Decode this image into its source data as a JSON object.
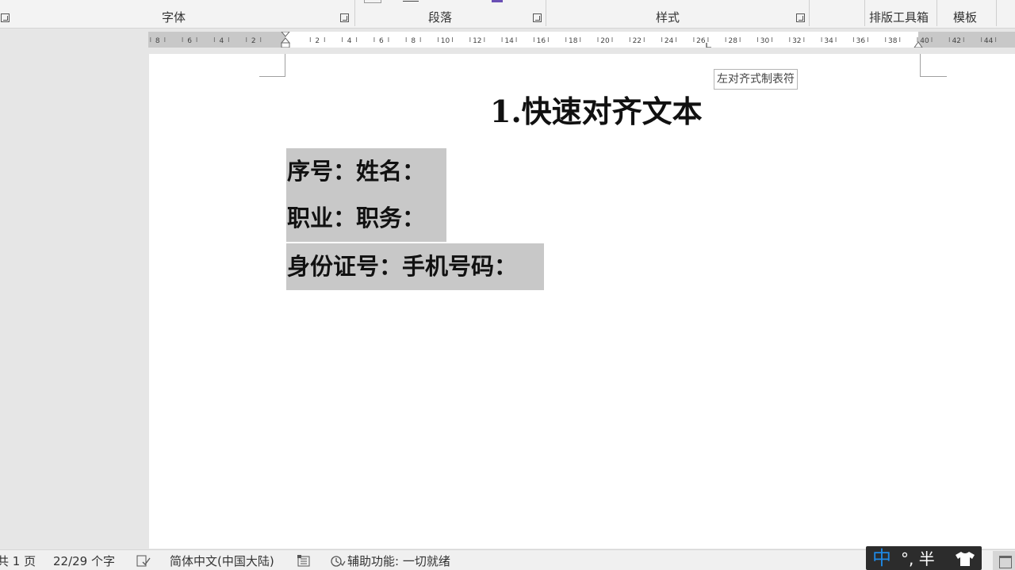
{
  "ribbon": {
    "groups": [
      {
        "label": "字体"
      },
      {
        "label": "段落"
      },
      {
        "label": "样式"
      },
      {
        "label": "排版工具箱"
      },
      {
        "label": "模板"
      }
    ]
  },
  "ruler": {
    "left_labels": [
      "8",
      "6",
      "4",
      "2"
    ],
    "right_labels": [
      "2",
      "4",
      "6",
      "8",
      "10",
      "12",
      "14",
      "16",
      "18",
      "20",
      "22",
      "24",
      "26",
      "28",
      "30",
      "32",
      "34",
      "36",
      "38",
      "40",
      "42",
      "44"
    ]
  },
  "tooltip": {
    "text": "左对齐式制表符"
  },
  "document": {
    "title": "1.快速对齐文本",
    "lines": [
      "序号：姓名：",
      "职业：职务：",
      "身份证号：手机号码："
    ]
  },
  "statusbar": {
    "page_count": "共 1 页",
    "word_count": "22/29 个字",
    "language": "简体中文(中国大陆)",
    "accessibility": "辅助功能: 一切就绪"
  },
  "ime": {
    "lang": "中",
    "mode": "°, 半"
  }
}
